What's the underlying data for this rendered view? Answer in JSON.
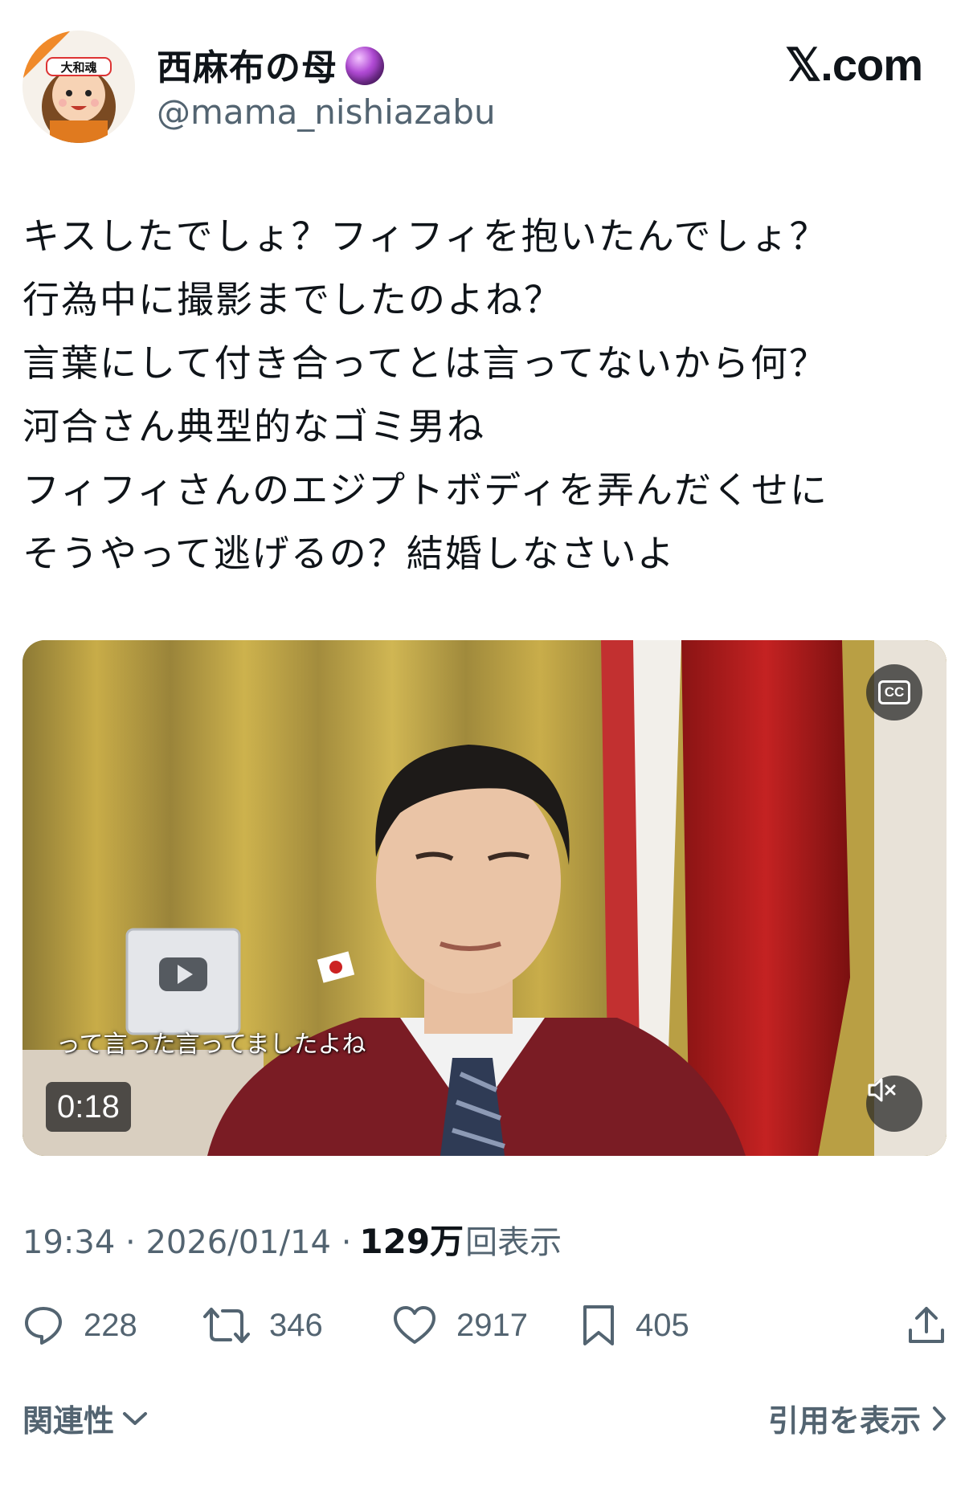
{
  "author": {
    "display_name": "西麻布の母",
    "name_badge_icon": "crystal-ball-icon",
    "handle": "@mama_nishiazabu",
    "avatar_text": "大和魂"
  },
  "brand": "𝕏.com",
  "tweet": {
    "lines": [
      "キスしたでしょ？フィフィを抱いたんでしょ？",
      "行為中に撮影までしたのよね？",
      "言葉にして付き合ってとは言ってないから何？",
      "河合さん典型的なゴミ男ね",
      "フィフィさんのエジプトボディを弄んだくせに",
      "そうやって逃げるの？結婚しなさいよ"
    ]
  },
  "video": {
    "caption": "って言った言ってましたよね",
    "duration": "0:18",
    "cc_label": "CC",
    "muted": true
  },
  "meta": {
    "time": "19:34",
    "date": "2026/01/14",
    "views_count": "129万",
    "views_label": "回表示"
  },
  "actions": {
    "replies": "228",
    "reposts": "346",
    "likes": "2917",
    "bookmarks": "405"
  },
  "footer": {
    "relevance_label": "関連性",
    "quotes_label": "引用を表示"
  },
  "colors": {
    "text": "#0f1419",
    "secondary": "#536471"
  }
}
